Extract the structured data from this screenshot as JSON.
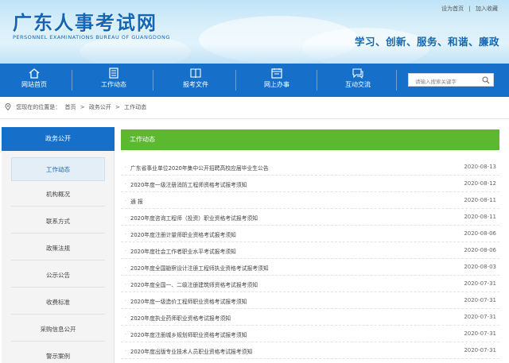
{
  "header": {
    "logo_cn": "广东人事考试网",
    "logo_en": "PERSONNEL EXAMINATIONS BUREAU OF GUANGDONG",
    "slogan": "学习、创新、服务、和谐、廉政",
    "top_links": [
      "设为首页",
      "|",
      "加入收藏"
    ]
  },
  "nav": {
    "items": [
      {
        "label": "网站首页",
        "icon": "home-icon"
      },
      {
        "label": "工作动态",
        "icon": "document-list-icon"
      },
      {
        "label": "报考文件",
        "icon": "book-icon"
      },
      {
        "label": "网上办事",
        "icon": "calendar-icon"
      },
      {
        "label": "互动交流",
        "icon": "chat-icon"
      }
    ],
    "search_placeholder": "请输入搜索关键字"
  },
  "breadcrumb": {
    "prefix": "您现在的位置是：",
    "items": [
      "首页",
      ">",
      "政务公开",
      ">",
      "工作动态"
    ]
  },
  "sidebar": {
    "heading": "政务公开",
    "items": [
      "工作动态",
      "机构概况",
      "联系方式",
      "政策法规",
      "公示公告",
      "收费标准",
      "采购信息公开",
      "警示案例"
    ],
    "active": "工作动态"
  },
  "content": {
    "heading": "工作动态",
    "rows": [
      {
        "title": "广东省事业单位2020年集中公开招聘高校应届毕业生公告",
        "date": "2020-08-13"
      },
      {
        "title": "2020年度一级注册消防工程师资格考试报考须知",
        "date": "2020-08-12"
      },
      {
        "title": "通  报",
        "date": "2020-08-11"
      },
      {
        "title": "2020年度咨询工程师（投资）职业资格考试报考须知",
        "date": "2020-08-11"
      },
      {
        "title": "2020年度注册计量师职业资格考试报考须知",
        "date": "2020-08-06"
      },
      {
        "title": "2020年度社会工作者职业水平考试报考须知",
        "date": "2020-08-06"
      },
      {
        "title": "2020年度全国勘察设计注册工程师执业资格考试报考须知",
        "date": "2020-08-03"
      },
      {
        "title": "2020年度全国一、二级注册建筑师资格考试报考须知",
        "date": "2020-07-31"
      },
      {
        "title": "2020年度一级造价工程师职业资格考试报考须知",
        "date": "2020-07-31"
      },
      {
        "title": "2020年度执业药师职业资格考试报考须知",
        "date": "2020-07-31"
      },
      {
        "title": "2020年度注册城乡规划师职业资格考试报考须知",
        "date": "2020-07-31"
      },
      {
        "title": "2020年度出版专业技术人员职业资格考试报考须知",
        "date": "2020-07-31"
      }
    ]
  },
  "colors": {
    "nav_blue": "#1670c9",
    "heading_green": "#5bb82f",
    "brand_blue": "#1366b3"
  }
}
